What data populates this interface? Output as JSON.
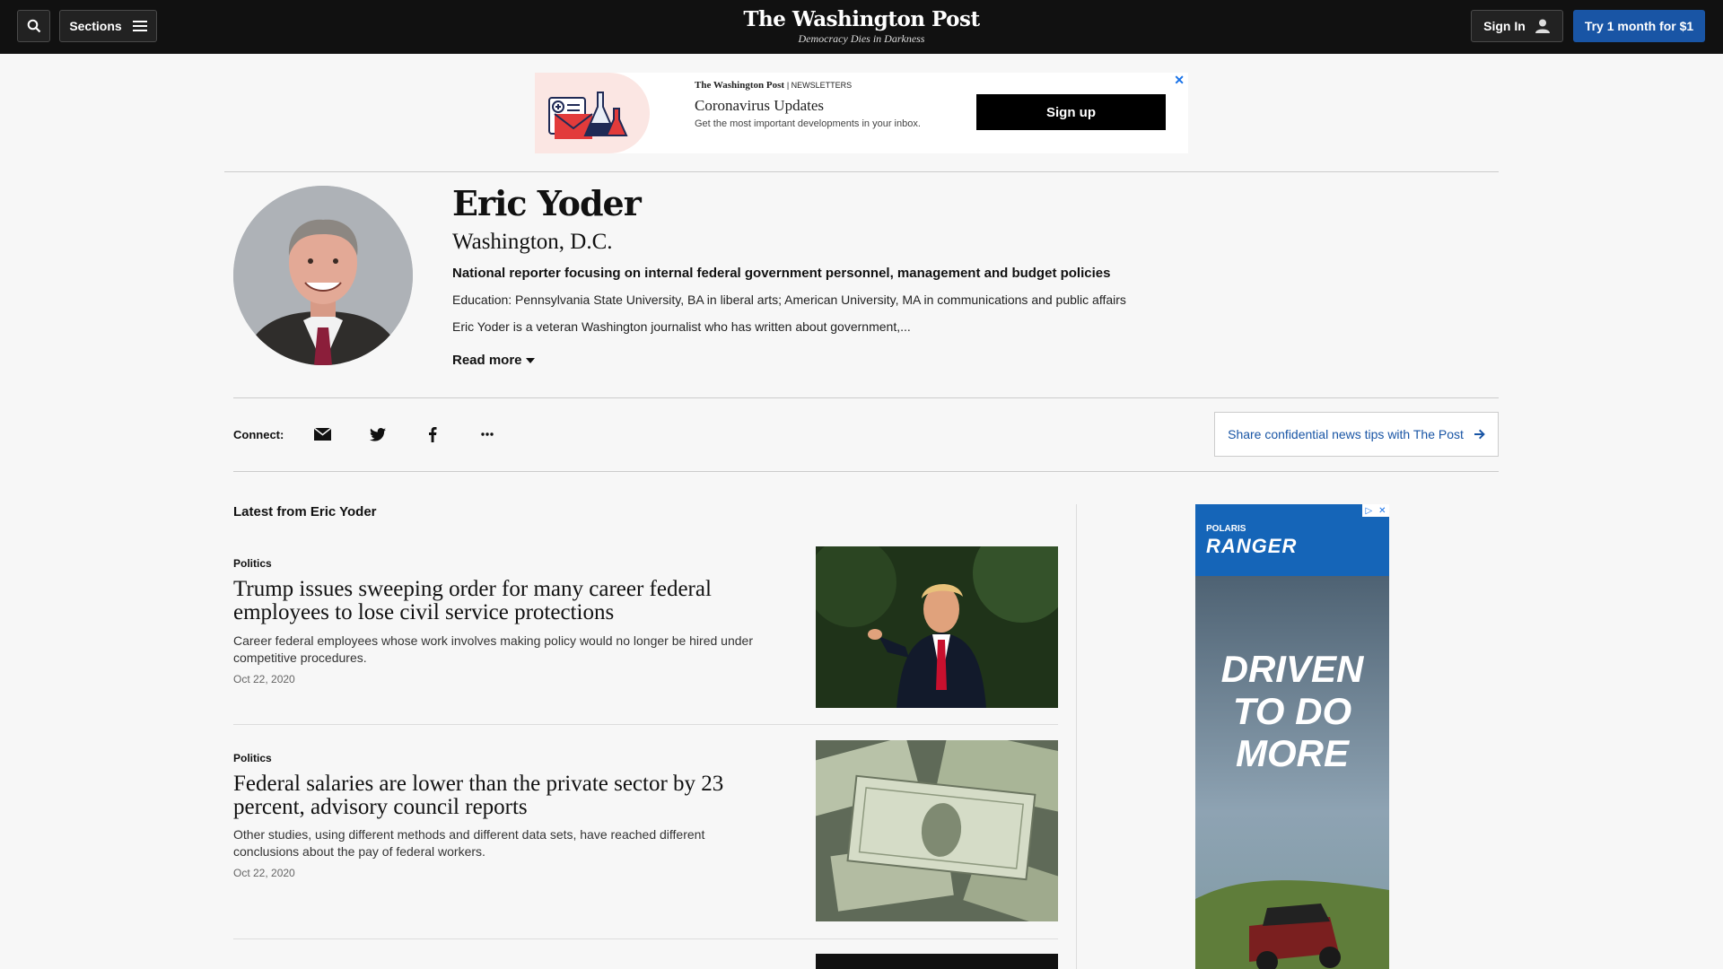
{
  "header": {
    "sections_label": "Sections",
    "logo": "The Washington Post",
    "tagline": "Democracy Dies in Darkness",
    "signin_label": "Sign In",
    "subscribe_label": "Try 1 month for $1"
  },
  "newsletter_ad": {
    "brand": "The Washington Post",
    "brand_suffix": "| NEWSLETTERS",
    "title": "Coronavirus Updates",
    "subtitle": "Get the most important developments in your inbox.",
    "cta_label": "Sign up",
    "close": "✕"
  },
  "profile": {
    "name": "Eric Yoder",
    "location": "Washington, D.C.",
    "role": "National reporter focusing on internal federal government personnel, management and budget policies",
    "education": "Education: Pennsylvania State University, BA in liberal arts; American University, MA in communications and public affairs",
    "bio": "Eric Yoder is a veteran Washington journalist who has written about government,...",
    "read_more_label": "Read more"
  },
  "connect": {
    "label": "Connect:",
    "tips_label": "Share confidential news tips with The Post"
  },
  "latest": {
    "heading": "Latest from Eric Yoder",
    "articles": [
      {
        "kicker": "Politics",
        "headline": "Trump issues sweeping order for many career federal employees to lose civil service protections",
        "blurb": "Career federal employees whose work involves making policy would no longer be hired under competitive procedures.",
        "date": "Oct 22, 2020"
      },
      {
        "kicker": "Politics",
        "headline": "Federal salaries are lower than the private sector by 23 percent, advisory council reports",
        "blurb": "Other studies, using different methods and different data sets, have reached different conclusions about the pay of federal workers.",
        "date": "Oct 22, 2020"
      }
    ]
  },
  "side_ad": {
    "brand": "POLARIS",
    "name": "RANGER",
    "copy_line1": "DRIVEN",
    "copy_line2": "TO DO",
    "copy_line3": "MORE"
  },
  "colors": {
    "topbar": "#111111",
    "accent_blue": "#1955a5",
    "page_bg": "#f7f7f7"
  }
}
